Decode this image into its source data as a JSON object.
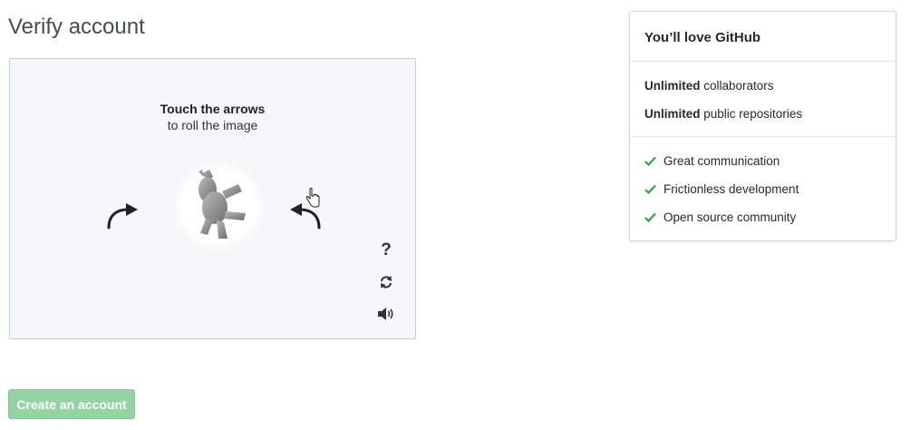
{
  "page": {
    "title": "Verify account"
  },
  "captcha": {
    "instruction_bold": "Touch the arrows",
    "instruction_rest": "to roll the image",
    "help_label": "?",
    "icons": {
      "rotate_left": "rotate-left-arrow-icon",
      "rotate_right": "rotate-right-arrow-icon",
      "image": "rotated-animal-image",
      "reload": "reload-icon",
      "audio": "speaker-icon",
      "cursor": "hand-pointer-icon"
    }
  },
  "actions": {
    "create_account_label": "Create an account",
    "create_account_disabled": true
  },
  "promo": {
    "title": "You’ll love GitHub",
    "features": [
      {
        "bold": "Unlimited",
        "rest": " collaborators"
      },
      {
        "bold": "Unlimited",
        "rest": " public repositories"
      }
    ],
    "checklist": [
      "Great communication",
      "Frictionless development",
      "Open source community"
    ]
  },
  "colors": {
    "button_disabled_green": "#94d3a2",
    "check_green": "#28a745",
    "captcha_background": "#f6f7f8"
  }
}
